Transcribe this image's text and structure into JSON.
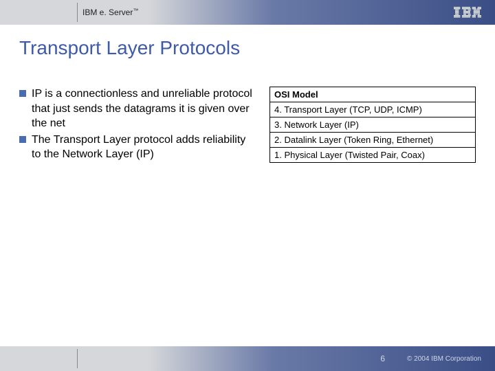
{
  "header": {
    "brand_prefix": "IBM e. Server",
    "brand_tm": "™"
  },
  "title": "Transport Layer Protocols",
  "bullets": [
    "IP is a connectionless and unreliable protocol that just sends the datagrams it is given over the net",
    "The Transport Layer protocol adds reliability to the Network Layer (IP)"
  ],
  "osi": {
    "heading": "OSI Model",
    "rows": [
      "4. Transport Layer (TCP, UDP, ICMP)",
      "3. Network Layer (IP)",
      "2. Datalink Layer (Token Ring, Ethernet)",
      "1. Physical Layer (Twisted Pair, Coax)"
    ]
  },
  "footer": {
    "page": "6",
    "copyright": "© 2004 IBM Corporation"
  }
}
